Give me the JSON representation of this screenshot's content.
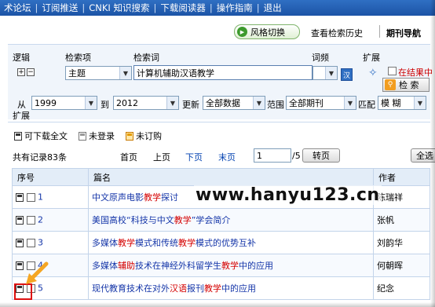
{
  "topnav": {
    "items": [
      "术论坛",
      "订阅推送",
      "CNKI 知识搜索",
      "下载阅读器",
      "操作指南",
      "退出"
    ]
  },
  "toolbar": {
    "style_switch": "风格切换",
    "history": "查看检索历史",
    "journal_nav": "期刊导航"
  },
  "search": {
    "logic_label": "逻辑",
    "field_label": "检索项",
    "term_label": "检索词",
    "freq_label": "词频",
    "expand_label": "扩展",
    "field_value": "主题",
    "term_value": "计算机辅助汉语教学",
    "in_results": "在结果中",
    "search_button": "检 索",
    "from_label": "从",
    "from_year": "1999",
    "to_label": "到",
    "to_year": "2012",
    "update_label": "更新",
    "update_value": "全部数据",
    "scope_label": "范围",
    "scope_value": "全部期刊",
    "match_label": "匹配",
    "match_value": "模 糊",
    "expand_label2": "扩展"
  },
  "legend": {
    "downloadable": "可下载全文",
    "not_logged": "未登录",
    "not_subscribed": "未订购"
  },
  "pager": {
    "count": "共有记录83条",
    "first": "首页",
    "prev": "上页",
    "next": "下页",
    "last": "末页",
    "page": "1",
    "total": "/5",
    "go": "转页",
    "select_all": "全选"
  },
  "table": {
    "headers": [
      "序号",
      "篇名",
      "作者"
    ],
    "rows": [
      {
        "num": "1",
        "title_parts": [
          "中文原声电影",
          "教学",
          "探讨"
        ],
        "author": "陈瑞祥"
      },
      {
        "num": "2",
        "title_parts": [
          "美国高校“科技与中文",
          "教学",
          "”学会简介"
        ],
        "author": "张帆"
      },
      {
        "num": "3",
        "title_parts": [
          "多媒体",
          "教学",
          "模式和传统",
          "教学",
          "模式的优势互补"
        ],
        "author": "刘韵华"
      },
      {
        "num": "4",
        "title_parts": [
          "多媒体",
          "辅助",
          "技术在神经外科留学生",
          "教学",
          "中的应用"
        ],
        "author": "何朝晖"
      },
      {
        "num": "5",
        "title_parts": [
          "现代教育技术在对外",
          "汉语",
          "报刊",
          "教学",
          "中的应用"
        ],
        "author": "纪念"
      }
    ]
  },
  "watermark": "www.hanyu123.cn",
  "colors": {
    "nav_bg": "#2360b5",
    "highlight": "#d40000",
    "link": "#1435a8",
    "annotation": "#d11111",
    "arrow": "#f5a623"
  }
}
